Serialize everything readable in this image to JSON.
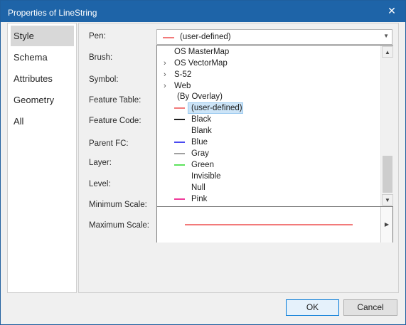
{
  "window": {
    "title": "Properties of LineString",
    "close_label": "✕"
  },
  "nav": {
    "items": [
      {
        "label": "Style",
        "active": true
      },
      {
        "label": "Schema"
      },
      {
        "label": "Attributes"
      },
      {
        "label": "Geometry"
      },
      {
        "label": "All"
      }
    ]
  },
  "fields": {
    "pen": "Pen:",
    "brush": "Brush:",
    "symbol": "Symbol:",
    "feature_table": "Feature Table:",
    "feature_code": "Feature Code:",
    "parent_fc": "Parent FC:",
    "layer": "Layer:",
    "level": "Level:",
    "minimum_scale": "Minimum Scale:",
    "maximum_scale": "Maximum Scale:"
  },
  "pen_combo": {
    "value": "(user-defined)",
    "swatch_color": "#f27a7a",
    "arrow": "▼"
  },
  "dropdown": {
    "groups": [
      {
        "label": "OS MasterMap",
        "chevron": ""
      },
      {
        "label": "OS VectorMap",
        "chevron": "›"
      },
      {
        "label": "S-52",
        "chevron": "›"
      },
      {
        "label": "Web",
        "chevron": "›"
      },
      {
        "label": "(By Overlay)",
        "chevron": ""
      }
    ],
    "pens": [
      {
        "label": "(user-defined)",
        "color": "#f27a7a",
        "selected": true
      },
      {
        "label": "Black",
        "color": "#1e1e1e"
      },
      {
        "label": "Blank",
        "color": ""
      },
      {
        "label": "Blue",
        "color": "#4a4af0"
      },
      {
        "label": "Gray",
        "color": "#a0a0a0"
      },
      {
        "label": "Green",
        "color": "#5ee35e"
      },
      {
        "label": "Invisible",
        "color": ""
      },
      {
        "label": "Null",
        "color": ""
      },
      {
        "label": "Pink",
        "color": "#f03a9a"
      }
    ],
    "scroll_up": "▲",
    "scroll_down": "▼",
    "preview_color": "#f27a7a",
    "preview_arrow": "▶"
  },
  "buttons": {
    "ok": "OK",
    "cancel": "Cancel"
  },
  "colors": {
    "titlebar": "#1e64a8",
    "selection": "#cce4f7",
    "ok_border": "#0078d7"
  }
}
